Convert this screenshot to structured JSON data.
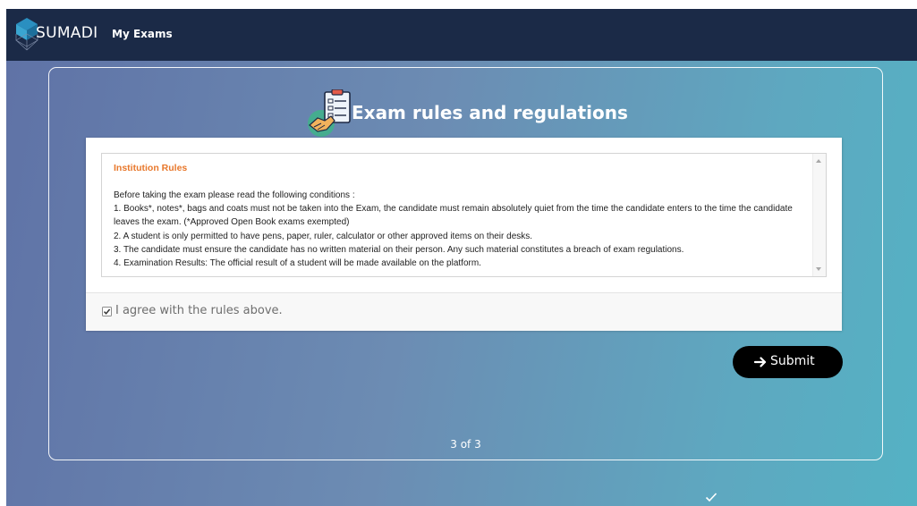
{
  "navbar": {
    "brand": "SUMADI",
    "link": "My Exams",
    "bg_color": "#1b2a47"
  },
  "page": {
    "title": "Exam rules and regulations",
    "title_icon": "clipboard-handshake-icon"
  },
  "rules": {
    "heading": "Institution Rules",
    "heading_color": "#e8782c",
    "intro": "Before taking the exam please read the following conditions :",
    "items": [
      "1. Books*, notes*, bags and coats must not be taken into the Exam, the candidate must remain absolutely quiet from the time the candidate enters to the time the candidate leaves the exam. (*Approved Open Book exams exempted)",
      "2. A student is only permitted to have pens, paper, ruler, calculator or other approved items on their desks.",
      "3. The candidate must ensure the candidate has no written material on their person. Any such material constitutes a breach of exam regulations.",
      "4. Examination Results: The official result of a student will be made available on the platform."
    ]
  },
  "agreement": {
    "label": "I agree with the rules above.",
    "checked": true
  },
  "submit": {
    "label": "Submit",
    "icon": "arrow-right-icon"
  },
  "pager": {
    "text": "3 of 3"
  }
}
